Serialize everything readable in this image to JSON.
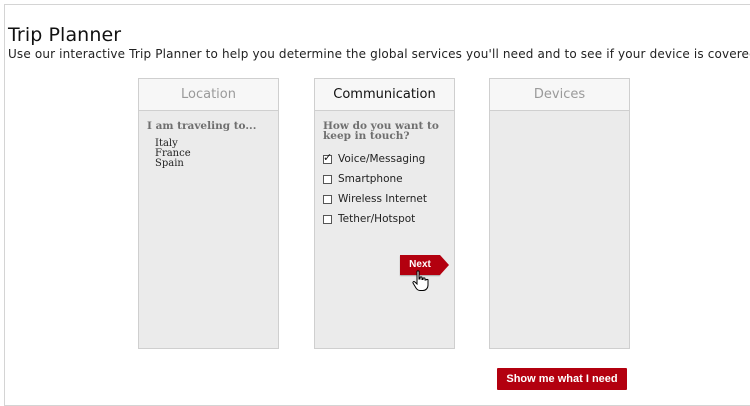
{
  "page": {
    "title": "Trip Planner",
    "subtitle": "Use our interactive Trip Planner to help you determine the global services you'll need and to see if your device is covered"
  },
  "panels": {
    "location": {
      "header": "Location",
      "prompt": "I am traveling to...",
      "destinations": [
        "Italy",
        "France",
        "Spain"
      ]
    },
    "communication": {
      "header": "Communication",
      "prompt_line1": "How do you want to",
      "prompt_line2": "keep in touch?",
      "options": [
        {
          "label": "Voice/Messaging",
          "checked": true
        },
        {
          "label": "Smartphone",
          "checked": false
        },
        {
          "label": "Wireless Internet",
          "checked": false
        },
        {
          "label": "Tether/Hotspot",
          "checked": false
        }
      ],
      "next_label": "Next"
    },
    "devices": {
      "header": "Devices"
    }
  },
  "show_button_label": "Show me what I need",
  "colors": {
    "accent": "#b3000f",
    "panel_bg": "#ebebeb",
    "header_bg": "#f7f7f7"
  },
  "icons": {
    "cursor": "hand-pointer-icon",
    "checkmark": "checkmark-icon"
  }
}
